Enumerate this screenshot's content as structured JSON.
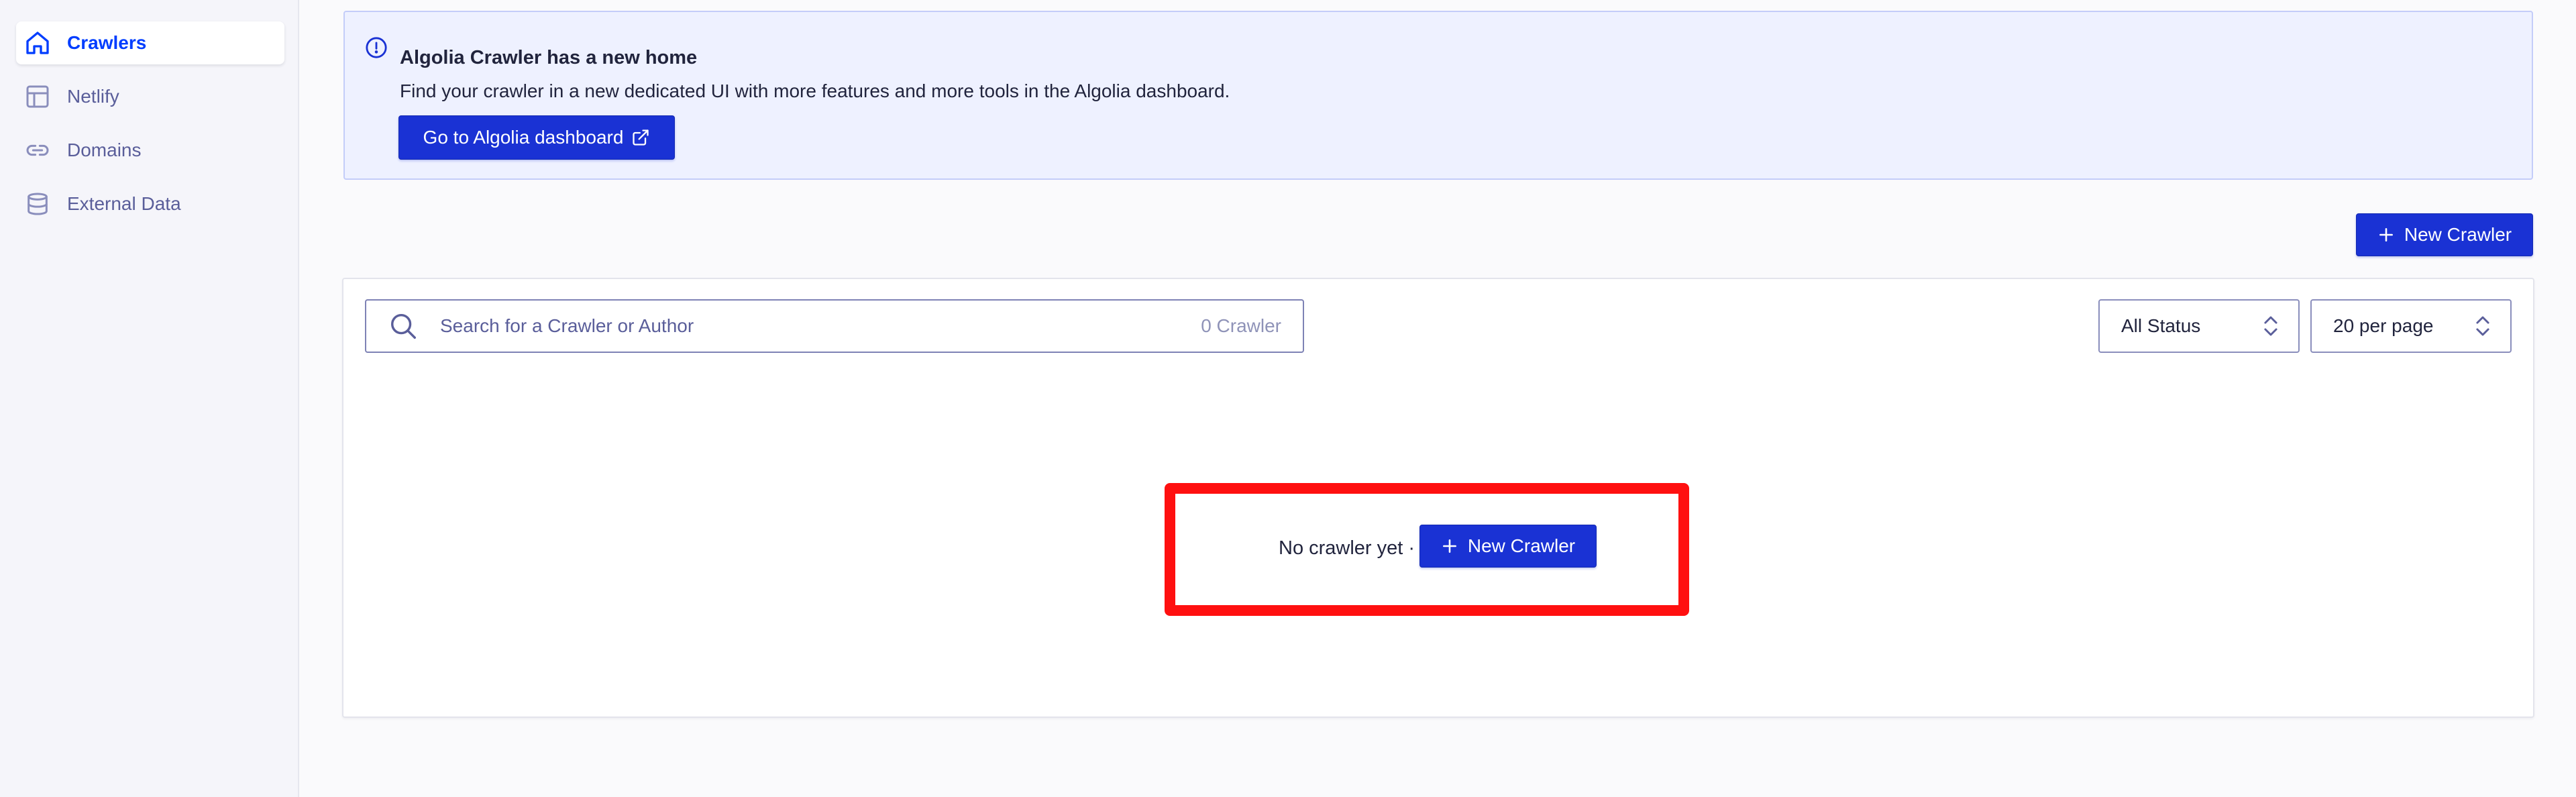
{
  "sidebar": {
    "items": [
      {
        "label": "Crawlers",
        "icon": "home-icon",
        "active": true
      },
      {
        "label": "Netlify",
        "icon": "layout-icon",
        "active": false
      },
      {
        "label": "Domains",
        "icon": "link-icon",
        "active": false
      },
      {
        "label": "External Data",
        "icon": "database-icon",
        "active": false
      }
    ]
  },
  "banner": {
    "icon": "info-icon",
    "title": "Algolia Crawler has a new home",
    "text": "Find your crawler in a new dedicated UI with more features and more tools in the Algolia dashboard.",
    "button_label": "Go to Algolia dashboard",
    "button_icon": "external-link-icon"
  },
  "toolbar": {
    "new_crawler_label": "New Crawler"
  },
  "search": {
    "placeholder": "Search for a Crawler or Author",
    "value": "",
    "count": "0 Crawler"
  },
  "filters": {
    "status_selected": "All Status",
    "per_page_selected": "20 per page"
  },
  "empty_state": {
    "text": "No crawler yet ·",
    "button_label": "New Crawler"
  },
  "colors": {
    "primary": "#1a32d4",
    "active_nav": "#003dff",
    "highlight": "#ff1010"
  }
}
